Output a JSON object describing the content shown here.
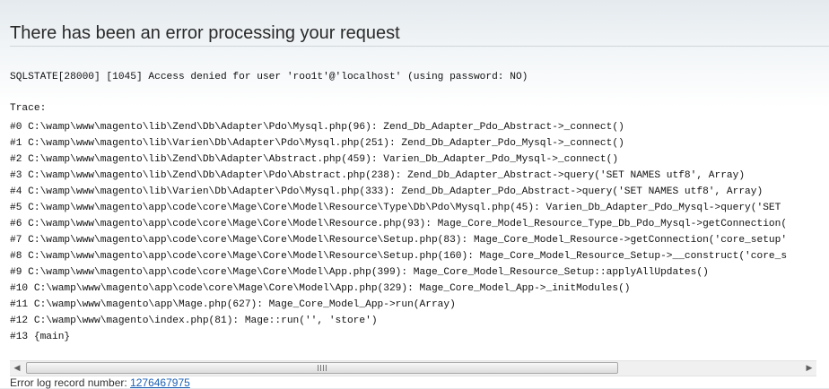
{
  "page": {
    "title": "There has been an error processing your request",
    "message": "SQLSTATE[28000] [1045] Access denied for user 'roo1t'@'localhost' (using password: NO)",
    "trace_heading": "Trace:",
    "trace": [
      "#0 C:\\wamp\\www\\magento\\lib\\Zend\\Db\\Adapter\\Pdo\\Mysql.php(96): Zend_Db_Adapter_Pdo_Abstract->_connect()",
      "#1 C:\\wamp\\www\\magento\\lib\\Varien\\Db\\Adapter\\Pdo\\Mysql.php(251): Zend_Db_Adapter_Pdo_Mysql->_connect()",
      "#2 C:\\wamp\\www\\magento\\lib\\Zend\\Db\\Adapter\\Abstract.php(459): Varien_Db_Adapter_Pdo_Mysql->_connect()",
      "#3 C:\\wamp\\www\\magento\\lib\\Zend\\Db\\Adapter\\Pdo\\Abstract.php(238): Zend_Db_Adapter_Abstract->query('SET NAMES utf8', Array)",
      "#4 C:\\wamp\\www\\magento\\lib\\Varien\\Db\\Adapter\\Pdo\\Mysql.php(333): Zend_Db_Adapter_Pdo_Abstract->query('SET NAMES utf8', Array)",
      "#5 C:\\wamp\\www\\magento\\app\\code\\core\\Mage\\Core\\Model\\Resource\\Type\\Db\\Pdo\\Mysql.php(45): Varien_Db_Adapter_Pdo_Mysql->query('SET",
      "#6 C:\\wamp\\www\\magento\\app\\code\\core\\Mage\\Core\\Model\\Resource.php(93): Mage_Core_Model_Resource_Type_Db_Pdo_Mysql->getConnection(",
      "#7 C:\\wamp\\www\\magento\\app\\code\\core\\Mage\\Core\\Model\\Resource\\Setup.php(83): Mage_Core_Model_Resource->getConnection('core_setup'",
      "#8 C:\\wamp\\www\\magento\\app\\code\\core\\Mage\\Core\\Model\\Resource\\Setup.php(160): Mage_Core_Model_Resource_Setup->__construct('core_s",
      "#9 C:\\wamp\\www\\magento\\app\\code\\core\\Mage\\Core\\Model\\App.php(399): Mage_Core_Model_Resource_Setup::applyAllUpdates()",
      "#10 C:\\wamp\\www\\magento\\app\\code\\core\\Mage\\Core\\Model\\App.php(329): Mage_Core_Model_App->_initModules()",
      "#11 C:\\wamp\\www\\magento\\app\\Mage.php(627): Mage_Core_Model_App->run(Array)",
      "#12 C:\\wamp\\www\\magento\\index.php(81): Mage::run('', 'store')",
      "#13 {main}"
    ],
    "scrollbar": {
      "left_icon": "arrow-left-icon",
      "right_icon": "arrow-right-icon",
      "grip_icon": "grip-icon"
    },
    "footer": {
      "label": "Error log record number:",
      "record_number": "1276467975"
    },
    "colors": {
      "link": "#1a5fb4",
      "title": "#2a2a2a"
    }
  }
}
